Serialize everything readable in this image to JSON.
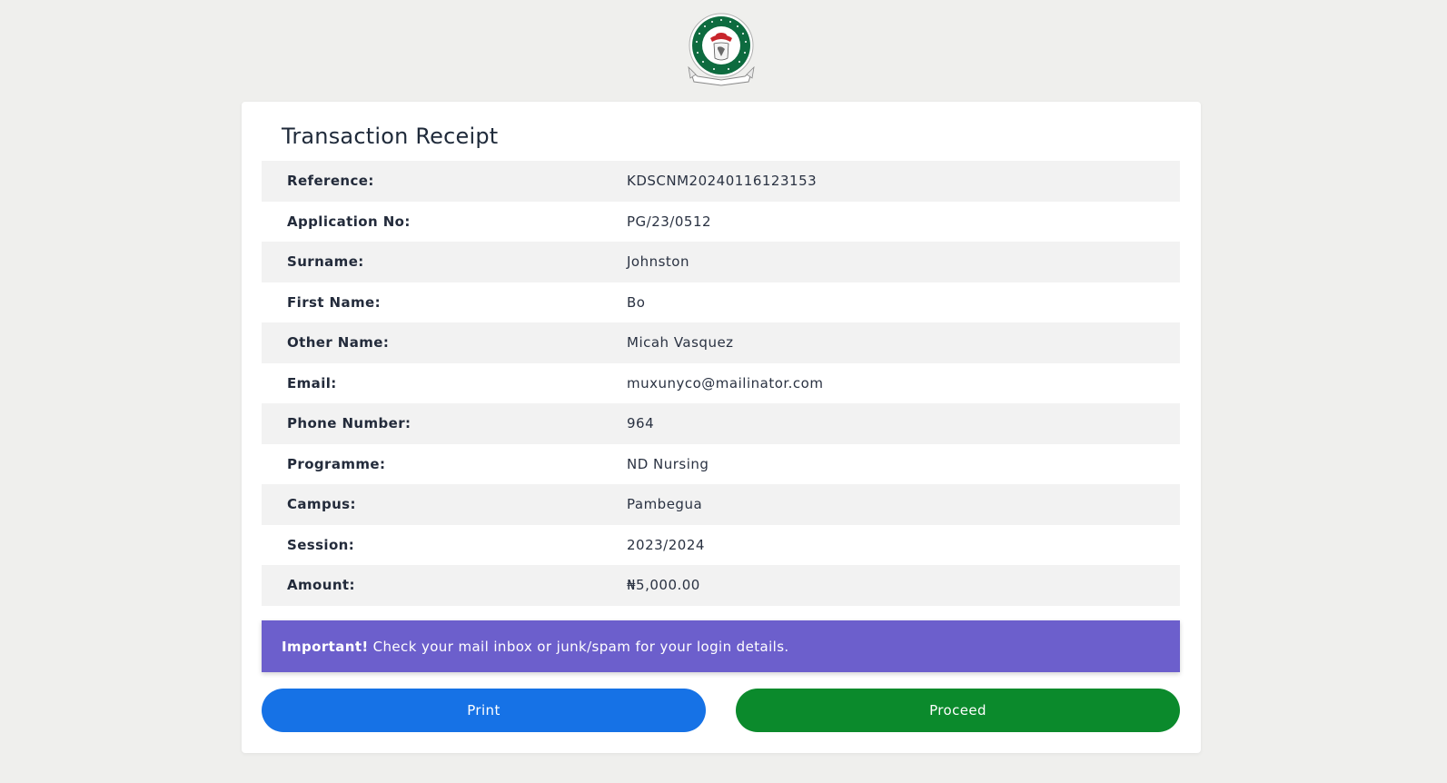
{
  "receipt": {
    "title": "Transaction Receipt",
    "rows": [
      {
        "label": "Reference:",
        "value": "KDSCNM20240116123153"
      },
      {
        "label": "Application No:",
        "value": "PG/23/0512"
      },
      {
        "label": "Surname:",
        "value": "Johnston"
      },
      {
        "label": "First Name:",
        "value": "Bo"
      },
      {
        "label": "Other Name:",
        "value": "Micah Vasquez"
      },
      {
        "label": "Email:",
        "value": "muxunyco@mailinator.com"
      },
      {
        "label": "Phone Number:",
        "value": "964"
      },
      {
        "label": "Programme:",
        "value": "ND Nursing"
      },
      {
        "label": "Campus:",
        "value": "Pambegua"
      },
      {
        "label": "Session:",
        "value": "2023/2024"
      },
      {
        "label": "Amount:",
        "value": "₦5,000.00"
      }
    ]
  },
  "alert": {
    "strong": "Important!",
    "text": "Check your mail inbox or junk/spam for your login details."
  },
  "buttons": {
    "print_label": "Print",
    "proceed_label": "Proceed"
  },
  "logo": {
    "icon": "college-seal-logo",
    "ring_text": "KADUNA STATE COLLEGE OF NURSING & MIDWIFERY"
  },
  "colors": {
    "alert_bg": "#6c5fcc",
    "print_bg": "#1672e6",
    "proceed_bg": "#0b8a2c",
    "seal_green": "#0d6b3f"
  }
}
